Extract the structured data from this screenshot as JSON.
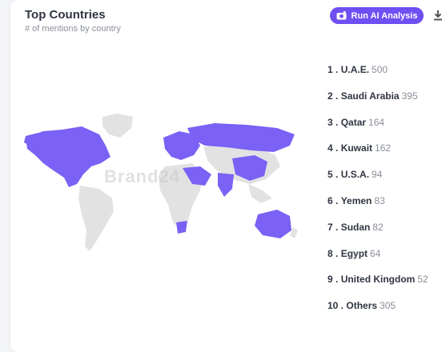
{
  "header": {
    "title": "Top Countries",
    "subtitle": "# of mentions by country",
    "ai_button_label": "Run AI Analysis"
  },
  "watermark": "Brand24",
  "colors": {
    "accent": "#6f4ef2",
    "map_highlight": "#7b61f5",
    "map_base": "#e2e2e2"
  },
  "icons": {
    "ai_button": "camera-sparkle-icon",
    "download": "download-icon"
  },
  "countries": [
    {
      "rank": "1 .",
      "name": "U.A.E.",
      "value": "500"
    },
    {
      "rank": "2 .",
      "name": "Saudi Arabia",
      "value": "395"
    },
    {
      "rank": "3 .",
      "name": "Qatar",
      "value": "164"
    },
    {
      "rank": "4 .",
      "name": "Kuwait",
      "value": "162"
    },
    {
      "rank": "5 .",
      "name": "U.S.A.",
      "value": "94"
    },
    {
      "rank": "6 .",
      "name": "Yemen",
      "value": "83"
    },
    {
      "rank": "7 .",
      "name": "Sudan",
      "value": "82"
    },
    {
      "rank": "8 .",
      "name": "Egypt",
      "value": "64"
    },
    {
      "rank": "9 .",
      "name": "United Kingdom",
      "value": "52"
    },
    {
      "rank": "10 .",
      "name": "Others",
      "value": "305"
    }
  ]
}
